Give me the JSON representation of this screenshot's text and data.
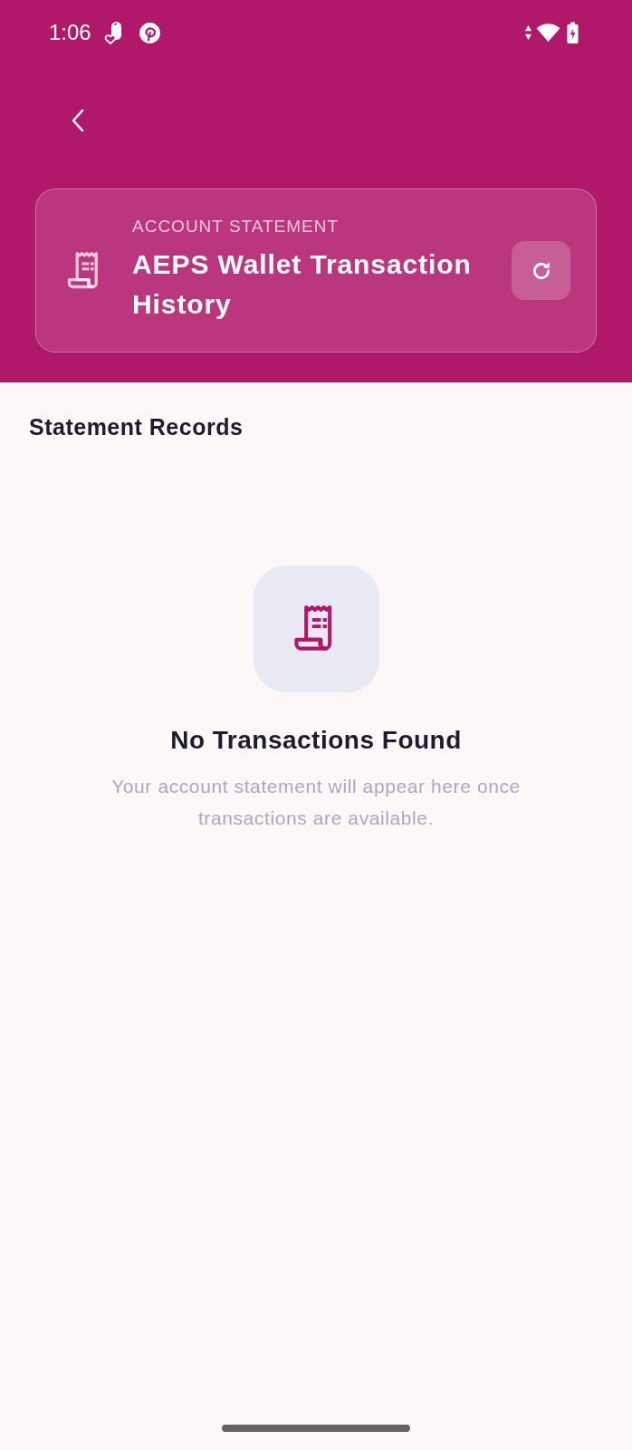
{
  "status_bar": {
    "time": "1:06"
  },
  "header": {
    "eyebrow": "ACCOUNT STATEMENT",
    "title": "AEPS Wallet Transaction History"
  },
  "section": {
    "title": "Statement Records"
  },
  "empty_state": {
    "title": "No Transactions Found",
    "message": "Your account statement will appear here once transactions are available."
  }
}
